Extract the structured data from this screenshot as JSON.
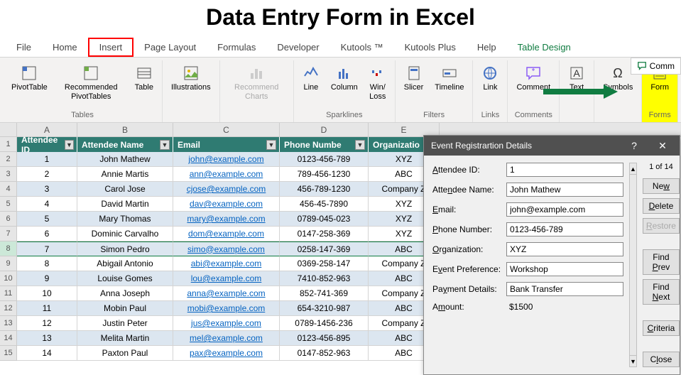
{
  "title": "Data Entry Form in Excel",
  "ribbon": {
    "tabs": [
      "File",
      "Home",
      "Insert",
      "Page Layout",
      "Formulas",
      "Developer",
      "Kutools ™",
      "Kutools Plus",
      "Help",
      "Table Design"
    ],
    "highlighted_tab_index": 2,
    "contextual_tab_index": 9,
    "groups": {
      "tables": {
        "label": "Tables",
        "pivottable": "PivotTable",
        "recpvt": "Recommended\nPivotTables",
        "table": "Table"
      },
      "illustrations": {
        "label": "",
        "btn": "Illustrations"
      },
      "charts": {
        "label": "",
        "btn": "Recommend\nCharts"
      },
      "sparklines": {
        "label": "Sparklines",
        "line": "Line",
        "column": "Column",
        "winloss": "Win/\nLoss"
      },
      "filters": {
        "label": "Filters",
        "slicer": "Slicer",
        "timeline": "Timeline"
      },
      "links": {
        "label": "Links",
        "link": "Link"
      },
      "comments": {
        "label": "Comments",
        "comment": "Comment"
      },
      "text": {
        "label": "",
        "btn": "Text"
      },
      "symbols": {
        "label": "",
        "btn": "Symbols"
      },
      "forms": {
        "label": "Forms",
        "form": "Form"
      }
    },
    "comments_btn": "Comm"
  },
  "columns": [
    "A",
    "B",
    "C",
    "D",
    "E"
  ],
  "headers": [
    "Attendee ID",
    "Attendee Name",
    "Email",
    "Phone Numbe",
    "Organizatio"
  ],
  "selected_row_index": 7,
  "rows": [
    {
      "id": "1",
      "name": "John Mathew",
      "email": "john@example.com",
      "phone": "0123-456-789",
      "org": "XYZ"
    },
    {
      "id": "2",
      "name": "Annie Martis",
      "email": "ann@example.com",
      "phone": "789-456-1230",
      "org": "ABC"
    },
    {
      "id": "3",
      "name": "Carol Jose",
      "email": "cjose@example.com",
      "phone": "456-789-1230",
      "org": "Company Z"
    },
    {
      "id": "4",
      "name": "David Martin",
      "email": "dav@example.com",
      "phone": "456-45-7890",
      "org": "XYZ"
    },
    {
      "id": "5",
      "name": "Mary Thomas",
      "email": "mary@example.com",
      "phone": "0789-045-023",
      "org": "XYZ"
    },
    {
      "id": "6",
      "name": "Dominic Carvalho",
      "email": "dom@example.com",
      "phone": "0147-258-369",
      "org": "XYZ"
    },
    {
      "id": "7",
      "name": "Simon Pedro",
      "email": "simo@example.com",
      "phone": "0258-147-369",
      "org": "ABC"
    },
    {
      "id": "8",
      "name": "Abigail Antonio",
      "email": "abi@example.com",
      "phone": "0369-258-147",
      "org": "Company Z"
    },
    {
      "id": "9",
      "name": "Louise Gomes",
      "email": "lou@example.com",
      "phone": "7410-852-963",
      "org": "ABC"
    },
    {
      "id": "10",
      "name": "Anna Joseph",
      "email": "anna@example.com",
      "phone": "852-741-369",
      "org": "Company Z"
    },
    {
      "id": "11",
      "name": "Mobin Paul",
      "email": "mobi@example.com",
      "phone": "654-3210-987",
      "org": "ABC"
    },
    {
      "id": "12",
      "name": "Justin Peter",
      "email": "jus@example.com",
      "phone": "0789-1456-236",
      "org": "Company Z"
    },
    {
      "id": "13",
      "name": "Melita Martin",
      "email": "mel@example.com",
      "phone": "0123-456-895",
      "org": "ABC"
    },
    {
      "id": "14",
      "name": "Paxton Paul",
      "email": "pax@example.com",
      "phone": "0147-852-963",
      "org": "ABC"
    }
  ],
  "dialog": {
    "title": "Event Registrartion Details",
    "counter": "1 of 14",
    "fields": {
      "attendee_id": {
        "label": "Attendee ID:",
        "value": "1"
      },
      "attendee_name": {
        "label": "Attendee Name:",
        "value": "John Mathew"
      },
      "email": {
        "label": "Email:",
        "value": "john@example.com"
      },
      "phone": {
        "label": "Phone Number:",
        "value": "0123-456-789"
      },
      "org": {
        "label": "Organization:",
        "value": "XYZ"
      },
      "event_pref": {
        "label": "Event Preference:",
        "value": "Workshop"
      },
      "payment": {
        "label": "Payment Details:",
        "value": "Bank Transfer"
      },
      "amount": {
        "label": "Amount:",
        "value": "$1500"
      }
    },
    "buttons": {
      "new": "New",
      "delete": "Delete",
      "restore": "Restore",
      "findprev": "Find Prev",
      "findnext": "Find Next",
      "criteria": "Criteria",
      "close": "Close"
    }
  }
}
